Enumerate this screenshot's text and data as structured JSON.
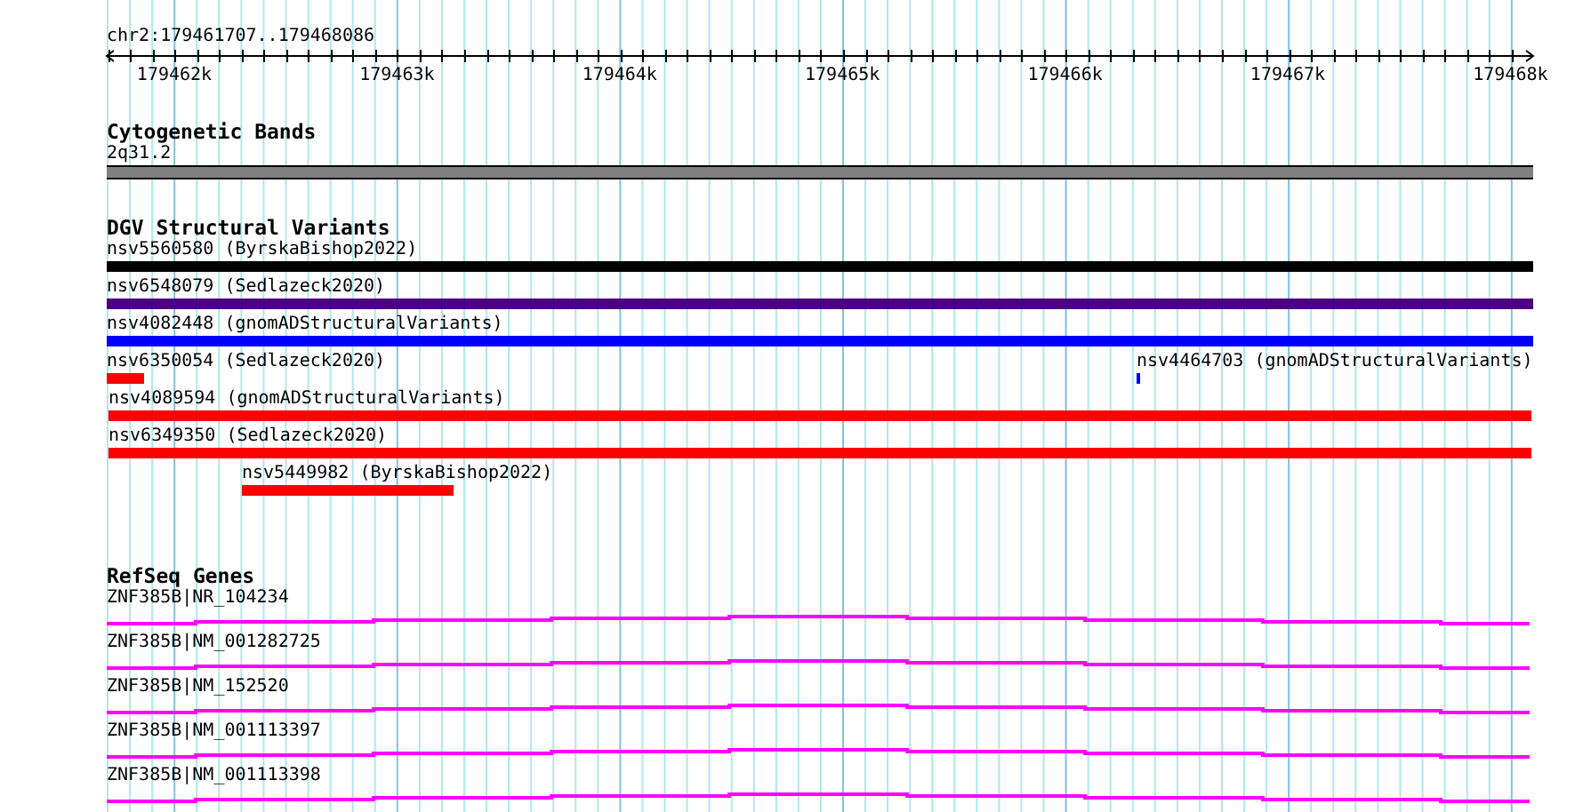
{
  "location": "chr2:179461707..179468086",
  "ruler": {
    "ticks": [
      "179462k",
      "179463k",
      "179464k",
      "179465k",
      "179466k",
      "179467k",
      "179468k"
    ]
  },
  "tracks": [
    {
      "kind": "bands",
      "title": "Cytogenetic Bands",
      "label": "2q31.2"
    },
    {
      "kind": "variants",
      "title": "DGV Structural Variants",
      "rows": [
        {
          "features": [
            {
              "label": "nsv5560580 (ByrskaBishop2022)",
              "color": "#000000"
            }
          ]
        },
        {
          "features": [
            {
              "label": "nsv6548079 (Sedlazeck2020)",
              "color": "#4b0082"
            }
          ]
        },
        {
          "features": [
            {
              "label": "nsv4082448 (gnomADStructuralVariants)",
              "color": "#0000ff"
            }
          ]
        },
        {
          "features": [
            {
              "label": "nsv6350054 (Sedlazeck2020)",
              "color": "#ff0000"
            },
            {
              "label": "nsv4464703 (gnomADStructuralVariants)",
              "color": "#0000ff"
            }
          ]
        },
        {
          "features": [
            {
              "label": "nsv4089594 (gnomADStructuralVariants)",
              "color": "#ff0000"
            }
          ]
        },
        {
          "features": [
            {
              "label": "nsv6349350 (Sedlazeck2020)",
              "color": "#ff0000"
            }
          ]
        },
        {
          "features": [
            {
              "label": "nsv5449982 (ByrskaBishop2022)",
              "color": "#ff0000"
            }
          ]
        }
      ]
    },
    {
      "kind": "genes",
      "title": "RefSeq Genes",
      "genes": [
        {
          "label": "ZNF385B|NR_104234"
        },
        {
          "label": "ZNF385B|NM_001282725"
        },
        {
          "label": "ZNF385B|NM_152520"
        },
        {
          "label": "ZNF385B|NM_001113397"
        },
        {
          "label": "ZNF385B|NM_001113398"
        }
      ]
    }
  ]
}
